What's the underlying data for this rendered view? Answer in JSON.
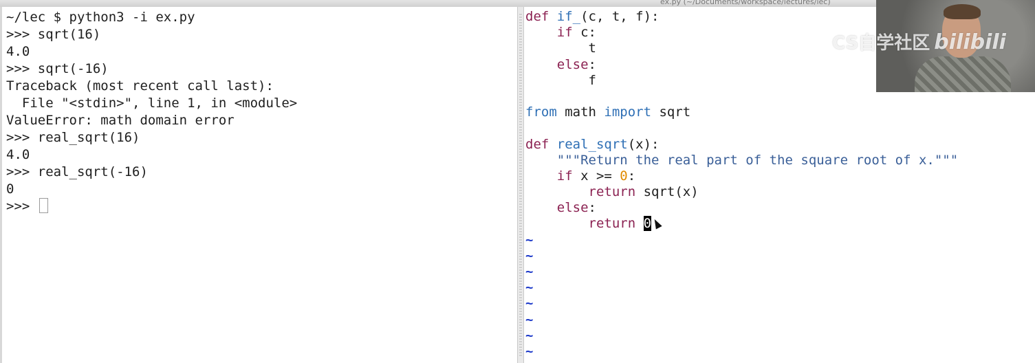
{
  "window_title": "ex.py (~/Documents/workspace/lectures/lec)",
  "terminal": {
    "lines": [
      "~/lec $ python3 -i ex.py",
      ">>> sqrt(16)",
      "4.0",
      ">>> sqrt(-16)",
      "Traceback (most recent call last):",
      "  File \"<stdin>\", line 1, in <module>",
      "ValueError: math domain error",
      ">>> real_sqrt(16)",
      "4.0",
      ">>> real_sqrt(-16)",
      "0",
      ">>> "
    ]
  },
  "editor": {
    "code": {
      "l1_kw": "def",
      "l1_fn": "if_",
      "l1_rest": "(c, t, f):",
      "l2_indent": "    ",
      "l2_kw": "if",
      "l2_rest": " c:",
      "l3": "        t",
      "l4_indent": "    ",
      "l4_kw": "else",
      "l4_rest": ":",
      "l5": "        f",
      "l7_from": "from",
      "l7_mod": " math ",
      "l7_import": "import",
      "l7_rest": " sqrt",
      "l9_kw": "def",
      "l9_fn": "real_sqrt",
      "l9_rest": "(x):",
      "l10_indent": "    ",
      "l10_str": "\"\"\"Return the real part of the square root of x.\"\"\"",
      "l11_indent": "    ",
      "l11_kw": "if",
      "l11_mid": " x >= ",
      "l11_num": "0",
      "l11_rest": ":",
      "l12_indent": "        ",
      "l12_kw": "return",
      "l12_rest": " sqrt(x)",
      "l13_indent": "    ",
      "l13_kw": "else",
      "l13_rest": ":",
      "l14_indent": "        ",
      "l14_kw": "return",
      "l14_sp": " ",
      "l14_cursor": "0"
    },
    "empty_marker": "~"
  },
  "overlay": {
    "watermark_prefix": "CS自学社区",
    "watermark_brand": "bilibili"
  },
  "colors": {
    "keyword": "#8b2252",
    "function_name": "#2e6fb5",
    "string": "#3a5f98",
    "number": "#e08a00",
    "tilde": "#1c39c9"
  }
}
